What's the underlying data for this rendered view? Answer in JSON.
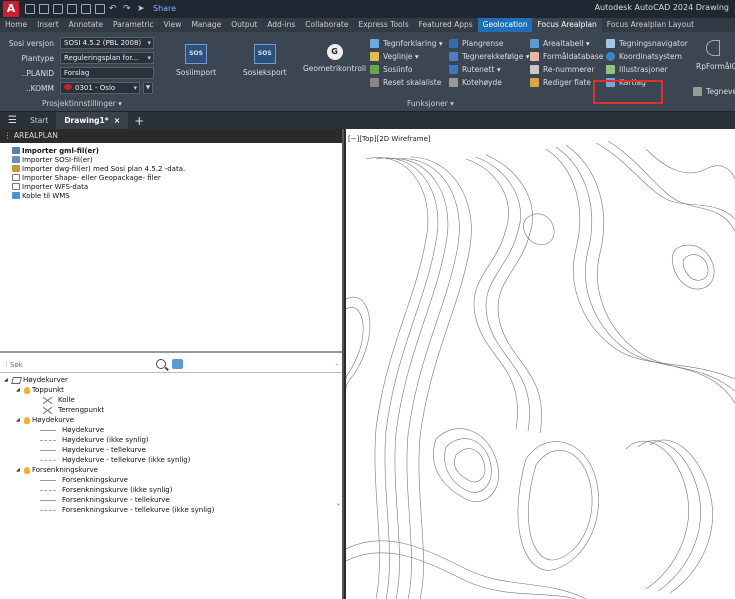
{
  "titlebar": {
    "logo": "A",
    "share": "Share",
    "title": "Autodesk AutoCAD 2024  Drawing"
  },
  "tabs": [
    "Home",
    "Insert",
    "Annotate",
    "Parametric",
    "View",
    "Manage",
    "Output",
    "Add-ins",
    "Collaborate",
    "Express Tools",
    "Featured Apps",
    "Geolocation",
    "Focus Arealplan",
    "Focus Arealplan Layout"
  ],
  "settings": {
    "rows": [
      {
        "label": "Sosi versjon",
        "value": "SOSI 4.5.2 (PBL 2008)"
      },
      {
        "label": "Plantype",
        "value": "Reguleringsplan for..."
      },
      {
        "label": "..PLANID",
        "value": "Forslag"
      },
      {
        "label": "..KOMM",
        "value": "0301 - Oslo"
      }
    ],
    "panel_label": "Prosjektinnstillinger"
  },
  "big_buttons": {
    "sosiimport": "Sosiimport",
    "sosieksport": "Sosieksport",
    "geometrikontroll": "Geometrikontroll",
    "sos_text": "SOS",
    "geo_text": "G"
  },
  "funksjoner": {
    "col1": [
      "Tegnforklaring",
      "Veglinje",
      "Sosiinfo",
      "Reset skalaliste"
    ],
    "col2": [
      "Plangrense",
      "Tegnerekkefølge",
      "Rutenett",
      "Kotehøyde"
    ],
    "col3": [
      "Arealtabell",
      "Formåldatabase",
      "Re-nummerer",
      "Rediger flate"
    ],
    "col4": [
      "Tegningsnavigator",
      "Koordinatsystem",
      "Illustrasjoner",
      "Kartlag"
    ],
    "panel_label": "Funksjoner"
  },
  "ribbon_right": {
    "rpformal": "RpFormålG",
    "tegnever": "Tegnever"
  },
  "doc_tabs": {
    "start": "Start",
    "drawing": "Drawing1*"
  },
  "left_panel": {
    "header": "AREALPLAN",
    "commands": [
      "Importer gml-fil(er)",
      "Importer SOSI-fil(er)",
      "Importer dwg-fil(er) med Sosi plan 4.5.2 -data.",
      "Importer Shape- eller Geopackage- filer",
      "Importer WFS-data",
      "Koble til WMS"
    ],
    "search_placeholder": "Søk"
  },
  "tree": {
    "root": "Høydekurver",
    "groups": [
      {
        "name": "Toppunkt",
        "items": [
          "Kolle",
          "Terrengpunkt"
        ]
      },
      {
        "name": "Høydekurve",
        "items": [
          "Høydekurve",
          "Høydekurve (ikke synlig)",
          "Høydekurve - tellekurve",
          "Høydekurve - tellekurve (ikke synlig)"
        ]
      },
      {
        "name": "Forsenkningskurve",
        "items": [
          "Forsenkningskurve",
          "Forsenkningskurve (ikke synlig)",
          "Forsenkningskurve - tellekurve",
          "Forsenkningskurve - tellekurve (ikke synlig)"
        ]
      }
    ]
  },
  "viewport": {
    "label": "[−][Top][2D Wireframe]"
  },
  "colors": {
    "accent": "#1d6fb8",
    "highlight": "#e0302e",
    "ribbon_bg": "#3c4552"
  }
}
